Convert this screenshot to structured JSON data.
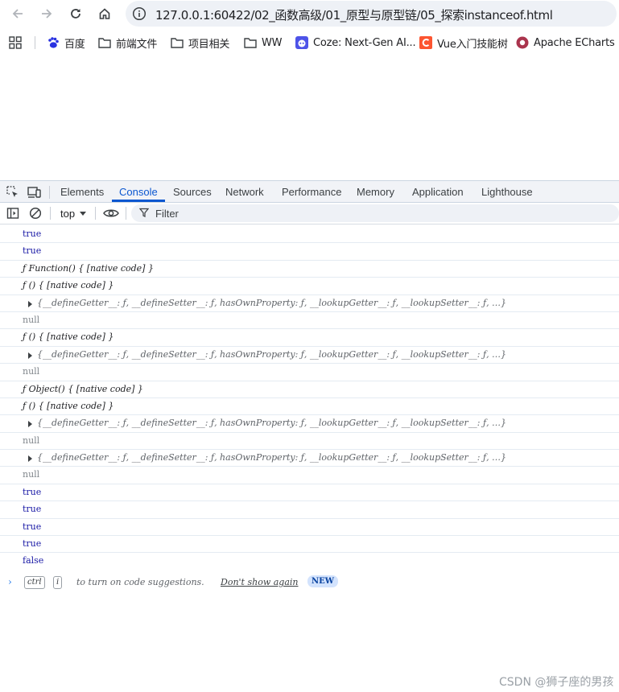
{
  "browser": {
    "url": "127.0.0.1:60422/02_函数高级/01_原型与原型链/05_探索instanceof.html"
  },
  "bookmarks": [
    {
      "label": "百度",
      "icon": "baidu-icon"
    },
    {
      "label": "前端文件",
      "icon": "folder-icon"
    },
    {
      "label": "项目相关",
      "icon": "folder-icon"
    },
    {
      "label": "WW",
      "icon": "folder-icon"
    },
    {
      "label": "Coze: Next-Gen AI...",
      "icon": "coze-icon"
    },
    {
      "label": "Vue入门技能树",
      "icon": "csdn-icon"
    },
    {
      "label": "Apache ECharts",
      "icon": "echarts-icon"
    }
  ],
  "devtools": {
    "tabs": [
      "Elements",
      "Console",
      "Sources",
      "Network",
      "Performance",
      "Memory",
      "Application",
      "Lighthouse"
    ],
    "active_tab": "Console",
    "context": "top",
    "filter_label": "Filter"
  },
  "console": {
    "lines": [
      {
        "kind": "bool",
        "text": "true"
      },
      {
        "kind": "bool",
        "text": "true"
      },
      {
        "kind": "fn",
        "text": "ƒ Function() { [native code] }"
      },
      {
        "kind": "fn",
        "text": "ƒ () { [native code] }"
      },
      {
        "kind": "obj",
        "text": "{__defineGetter__: ƒ, __defineSetter__: ƒ, hasOwnProperty: ƒ, __lookupGetter__: ƒ, __lookupSetter__: ƒ, …}"
      },
      {
        "kind": "null",
        "text": "null"
      },
      {
        "kind": "fn",
        "text": "ƒ () { [native code] }"
      },
      {
        "kind": "obj",
        "text": "{__defineGetter__: ƒ, __defineSetter__: ƒ, hasOwnProperty: ƒ, __lookupGetter__: ƒ, __lookupSetter__: ƒ, …}"
      },
      {
        "kind": "null",
        "text": "null"
      },
      {
        "kind": "fn",
        "text": "ƒ Object() { [native code] }"
      },
      {
        "kind": "fn",
        "text": "ƒ () { [native code] }"
      },
      {
        "kind": "obj",
        "text": "{__defineGetter__: ƒ, __defineSetter__: ƒ, hasOwnProperty: ƒ, __lookupGetter__: ƒ, __lookupSetter__: ƒ, …}"
      },
      {
        "kind": "null",
        "text": "null"
      },
      {
        "kind": "obj",
        "text": "{__defineGetter__: ƒ, __defineSetter__: ƒ, hasOwnProperty: ƒ, __lookupGetter__: ƒ, __lookupSetter__: ƒ, …}"
      },
      {
        "kind": "null",
        "text": "null"
      },
      {
        "kind": "bool",
        "text": "true"
      },
      {
        "kind": "bool",
        "text": "true"
      },
      {
        "kind": "bool",
        "text": "true"
      },
      {
        "kind": "bool",
        "text": "true"
      },
      {
        "kind": "bool",
        "text": "false"
      }
    ],
    "prompt": {
      "key1": "ctrl",
      "key2": "i",
      "hint": "to turn on code suggestions.",
      "dont_show": "Don't show again",
      "badge": "NEW"
    }
  },
  "watermark": "CSDN @狮子座的男孩"
}
